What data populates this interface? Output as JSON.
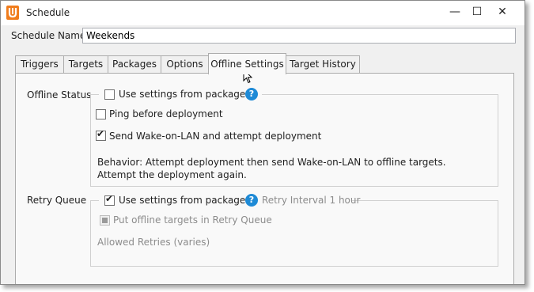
{
  "window": {
    "title": "Schedule",
    "controls": {
      "minimize": "—",
      "maximize": "☐",
      "close": "✕"
    }
  },
  "schedule_name": {
    "label": "Schedule Name",
    "value": "Weekends"
  },
  "tabs": [
    {
      "label": "Triggers",
      "active": false
    },
    {
      "label": "Targets",
      "active": false
    },
    {
      "label": "Packages",
      "active": false
    },
    {
      "label": "Options",
      "active": false
    },
    {
      "label": "Offline Settings",
      "active": true
    },
    {
      "label": "Target History",
      "active": false
    }
  ],
  "offline_status": {
    "label": "Offline Status",
    "use_package_settings": {
      "label": "Use settings from package(s)",
      "checked": false
    },
    "ping_before_deployment": {
      "label": "Ping before deployment",
      "checked": false
    },
    "send_wol": {
      "label": "Send Wake-on-LAN and attempt deployment",
      "checked": true
    },
    "behavior": "Behavior: Attempt deployment then send Wake-on-LAN to offline targets. Attempt the deployment again."
  },
  "retry_queue": {
    "label": "Retry Queue",
    "use_package_settings": {
      "label": "Use settings from package(s)",
      "checked": true
    },
    "retry_interval": "Retry Interval  1 hour",
    "put_offline_in_queue": {
      "label": "Put offline targets in Retry Queue",
      "checked": true,
      "disabled": true
    },
    "allowed_retries": "Allowed Retries  (varies)"
  },
  "icons": {
    "help": "?"
  },
  "colors": {
    "help_blue": "#1e8ad6",
    "app_icon_orange": "#f07c1c"
  }
}
